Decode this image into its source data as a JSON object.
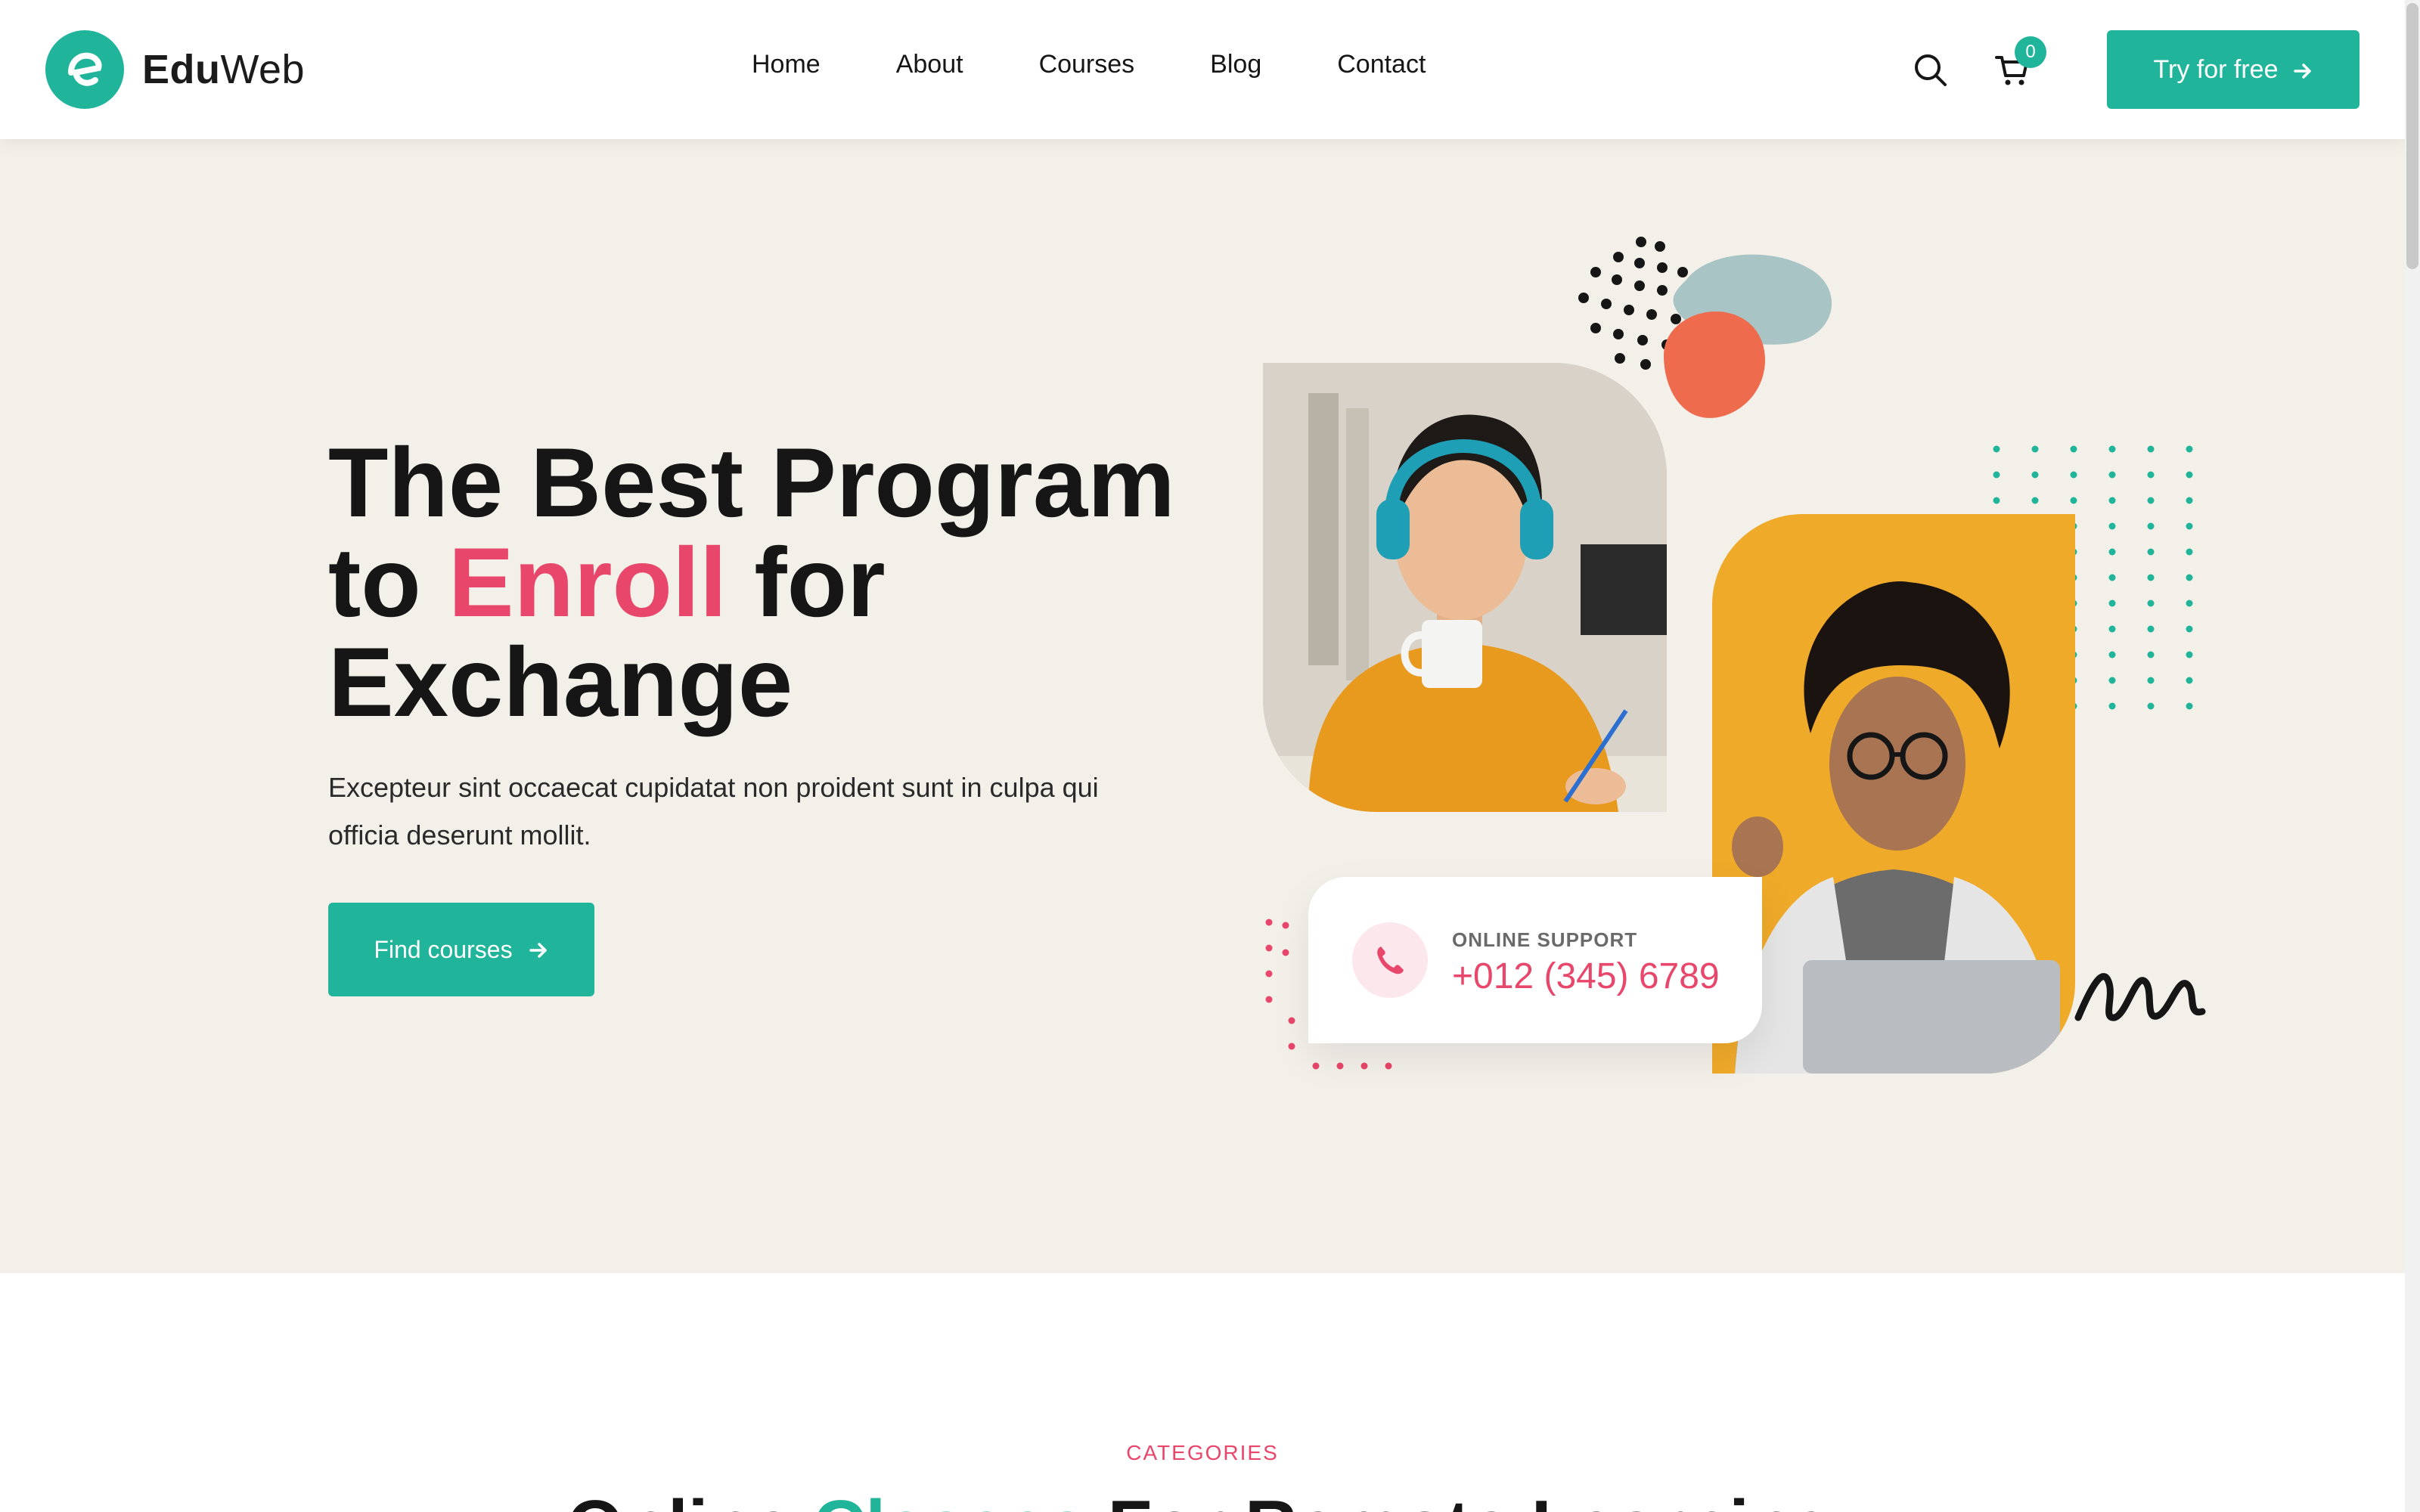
{
  "brand": {
    "name_strong": "Edu",
    "name_light": "Web",
    "accent_color": "#20b59a",
    "secondary_color": "#e8466a"
  },
  "nav": {
    "items": [
      "Home",
      "About",
      "Courses",
      "Blog",
      "Contact"
    ]
  },
  "header": {
    "cart_count": "0",
    "cta_label": "Try for free",
    "icons": [
      "search-icon",
      "cart-icon",
      "arrow-right-icon"
    ]
  },
  "hero": {
    "title_line1": "The Best Program",
    "title_to": "to ",
    "title_accent": "Enroll",
    "title_for": " for",
    "title_line3": "Exchange",
    "description": "Excepteur sint occaecat cupidatat non proident sunt in culpa qui officia deserunt mollit.",
    "button_label": "Find courses",
    "support_label": "ONLINE SUPPORT",
    "support_phone": "+012 (345) 6789"
  },
  "categories": {
    "label": "CATEGORIES",
    "title_start": "Online ",
    "title_accent": "Classes",
    "title_end": " For Remote Learning"
  }
}
